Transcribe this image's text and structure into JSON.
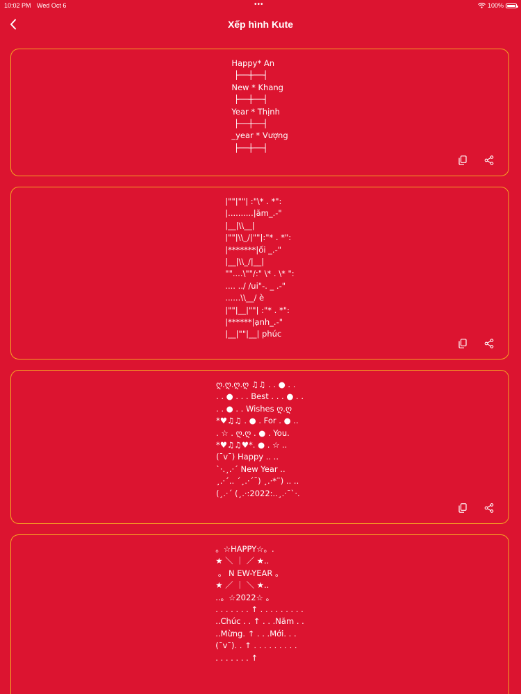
{
  "status": {
    "time": "10:02 PM",
    "date": "Wed Oct 6",
    "battery": "100%"
  },
  "header": {
    "title": "Xếp hình Kute"
  },
  "cards": [
    {
      "text": "Happy* An\n ├──┼──┤\nNew * Khang\n ├──┼──┤\nYear * Thịnh\n ├──┼──┤\n_year * Vượng\n ├──┼──┤"
    },
    {
      "text": "|\"\"|\"\"| :\"\\* . *\":\n|..........|ăm_.-\"\n|__|\\\\__|\n|\"\"|\\\\_/|\"\"|:\"* . *\":\n|*******|ối _.-\"\n|__|\\\\_/|__|\n\"\"....\\\"\"/:\" \\* . \\* \":\n.... ../ /ui\"-. _ .-\"\n......\\\\__/ è\n|\"\"|__|\"\"| :\"* . *\":\n|******|ạnh_.-\"\n|__|\"\"|__| phúc"
    },
    {
      "text": "ღ.ღ.ღ.ღ ♫♫ . . ● . .\n. . ● . . . Best . . . ● . .\n. . ● . . Wishes ღ.ღ\n*♥♫♫ . ● . For . ● ..\n. ☆ . ღ.ღ . ● . You.\n*♥♫♫♥*. ● . ☆ ..\n(¯v¯) Happy .. ..\n`·.¸.·´ New Year ..\n¸.·´.. ´¸.·´¯) ¸.·*¨) .. ..\n(¸.·´ (¸.·:2022:..¸.·¯`·."
    },
    {
      "text": "。☆HAPPY☆。.\n★ ＼ ｜ ／ ★..\n 。 N EW-YEAR 。\n★ ／ ｜ ＼ ★..\n..。☆2022☆ 。\n. . . . . . . ↑ . . . . . . . . .\n..Chúc . . ↑ . . .Năm . .\n..Mừng. ↑ . . .Mới. . .\n(¯v¯). . ↑ . . . . . . . . .\n. . . . . . . ↑"
    }
  ],
  "icons": {
    "back": "chevron-left-icon",
    "copy": "copy-icon",
    "share": "share-icon"
  },
  "colors": {
    "background": "#dc1430",
    "card_border": "#f5a623",
    "text": "#ffffff"
  }
}
